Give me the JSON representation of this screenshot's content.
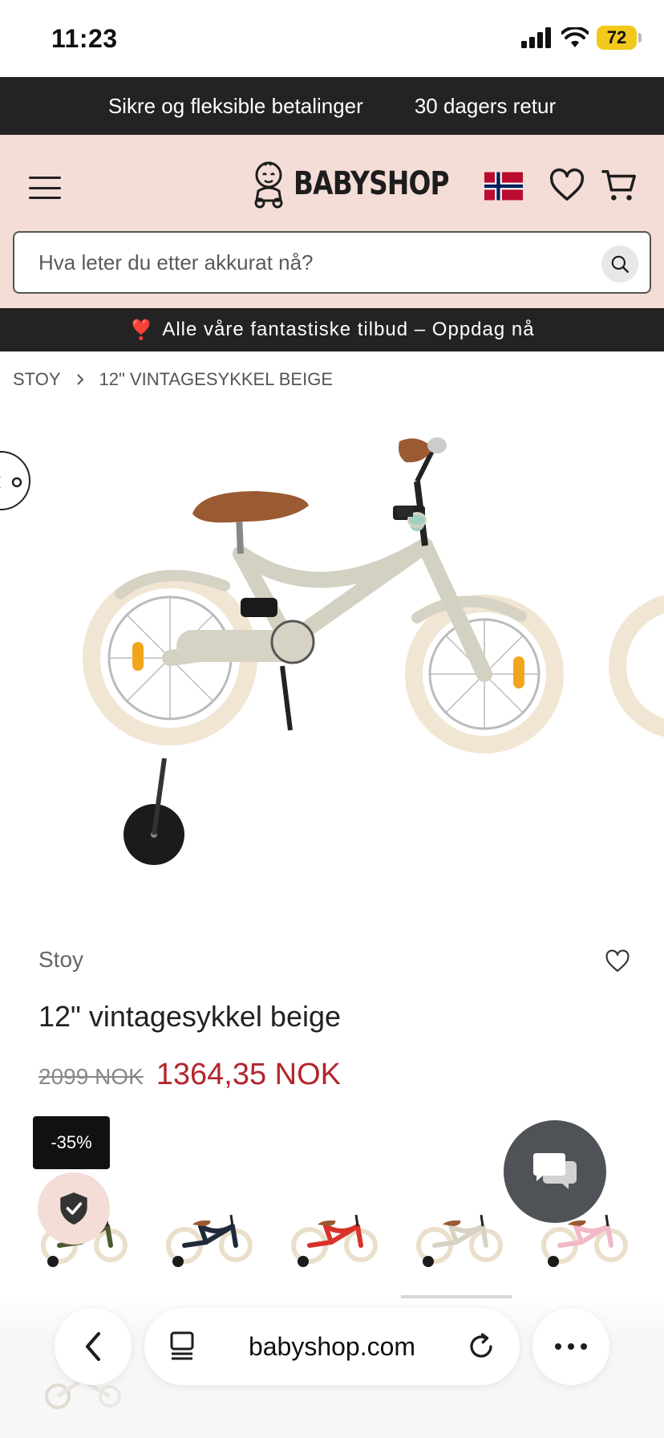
{
  "status": {
    "time": "11:23",
    "battery": "72"
  },
  "promo": {
    "payments": "Sikre og fleksible betalinger",
    "returns": "30 dagers retur"
  },
  "header": {
    "logo_text": "BABYSHOP"
  },
  "search": {
    "placeholder": "Hva leter du etter akkurat nå?"
  },
  "offer": {
    "emoji": "❣️",
    "text": "Alle våre fantastiske tilbud – Oppdag nå"
  },
  "breadcrumb": {
    "items": [
      "STOY",
      "12\" VINTAGESYKKEL BEIGE"
    ]
  },
  "product": {
    "brand": "Stoy",
    "title": "12\" vintagesykkel beige",
    "old_price": "2099 NOK",
    "new_price": "1364,35 NOK",
    "discount": "-35%"
  },
  "thumbnails": [
    {
      "color": "#4f5a2e",
      "selected": false
    },
    {
      "color": "#1f2a3a",
      "selected": false
    },
    {
      "color": "#d8322a",
      "selected": false
    },
    {
      "color": "#d6d3c4",
      "selected": true
    },
    {
      "color": "#f1b8c8",
      "selected": false
    }
  ],
  "browser": {
    "url": "babyshop.com"
  },
  "colors": {
    "accent_red": "#b3262d",
    "header_pink": "#f4ddd7",
    "dark_bar": "#222322"
  }
}
